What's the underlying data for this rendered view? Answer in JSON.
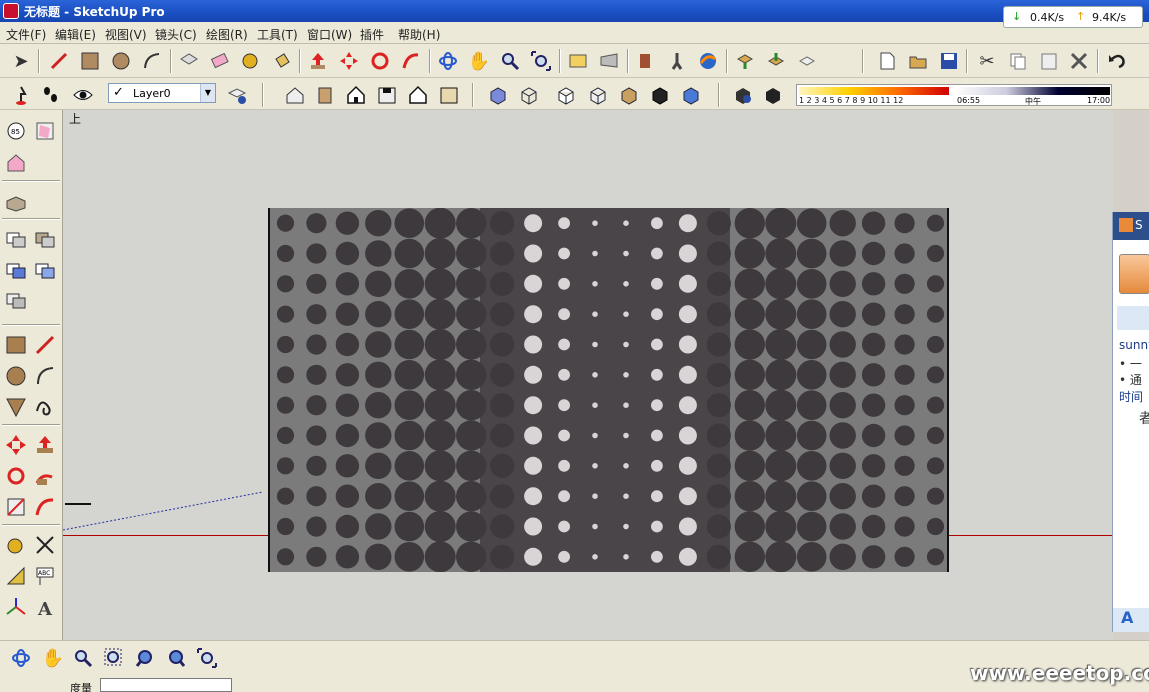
{
  "window": {
    "title": "无标题 - SketchUp Pro"
  },
  "net_speed": {
    "down": "0.4K/s",
    "up": "9.4K/s"
  },
  "menu": [
    "文件(F)",
    "编辑(E)",
    "视图(V)",
    "镜头(C)",
    "绘图(R)",
    "工具(T)",
    "窗口(W)",
    "插件",
    "帮助(H)"
  ],
  "layer": {
    "current": "Layer0"
  },
  "shadow": {
    "months": "1  2  3  4  5  6  7  8  9  10 11 12",
    "time_start": "06:55",
    "time_mid": "中午",
    "time_end": "17:00"
  },
  "viewport": {
    "view_label": "上"
  },
  "right_panel": {
    "header": "S",
    "lines": [
      "sunny",
      "• 一",
      "• 通",
      "时间",
      "者"
    ],
    "bottom_icon": "A"
  },
  "status": {
    "measure_label": "度量",
    "measure_value": ""
  },
  "watermark": "www.eeeetop.com",
  "icons": {
    "toolbar_1": [
      "select-arrow-icon",
      "pencil-line-icon",
      "rectangle-icon",
      "circle-icon",
      "arc-icon",
      "make-component-icon",
      "eraser-icon",
      "tape-measure-icon",
      "paint-bucket-icon",
      "push-pull-icon",
      "move-icon",
      "rotate-icon",
      "follow-me-icon",
      "orbit-icon",
      "pan-hand-icon",
      "zoom-icon",
      "zoom-extents-icon",
      "previous-view-icon",
      "next-view-icon",
      "position-camera-icon",
      "walk-icon",
      "look-around-icon",
      "get-models-icon",
      "share-model-icon",
      "share-component-icon",
      "new-file-icon",
      "open-file-icon",
      "save-file-icon",
      "cut-icon",
      "copy-icon",
      "paste-icon",
      "delete-icon",
      "undo-icon"
    ],
    "toolbar_2": [
      "section-plane-icon",
      "footprint-icon",
      "eye-icon",
      "layer-manager-icon",
      "iso-view-icon",
      "top-view-icon",
      "front-view-icon",
      "right-view-icon",
      "back-view-icon",
      "left-view-icon",
      "xray-icon",
      "wireframe-icon",
      "hidden-line-icon",
      "shaded-icon",
      "shaded-texture-icon",
      "monochrome-icon",
      "shadow-info-icon",
      "shadow-toggle-icon"
    ],
    "left_palette": [
      "orbit-tool-icon",
      "section-box-icon",
      "house-icon",
      "component-icon",
      "component-2-icon",
      "component-3-icon",
      "component-4-icon",
      "component-5-icon",
      "component-6-icon",
      "rectangle-tool-icon",
      "pencil-tool-icon",
      "circle-tool-icon",
      "arc-tool-icon",
      "polygon-tool-icon",
      "freehand-tool-icon",
      "move-tool-icon",
      "push-pull-tool-icon",
      "rotate-tool-icon",
      "follow-me-tool-icon",
      "scale-tool-icon",
      "offset-tool-icon",
      "tape-tool-icon",
      "dimension-tool-icon",
      "protractor-tool-icon",
      "text-tool-icon",
      "axes-tool-icon",
      "3d-text-tool-icon"
    ],
    "bottom_toolbar": [
      "orbit-icon",
      "pan-icon",
      "zoom-icon",
      "zoom-window-icon",
      "previous-icon",
      "next-icon",
      "zoom-extents-icon"
    ]
  }
}
